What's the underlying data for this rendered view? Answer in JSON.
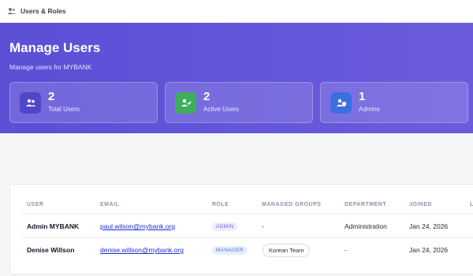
{
  "topbar": {
    "title": "Users & Roles",
    "icon": "users-icon"
  },
  "header": {
    "title": "Manage Users",
    "subtitle": "Manage users for MYBANK",
    "stats": [
      {
        "value": "2",
        "label": "Total Users",
        "icon": "users-icon",
        "color": "#4f46c8"
      },
      {
        "value": "2",
        "label": "Active Users",
        "icon": "user-check-icon",
        "color": "#3fae5a"
      },
      {
        "value": "1",
        "label": "Admins",
        "icon": "user-shield-icon",
        "color": "#3b6fe0"
      }
    ]
  },
  "table": {
    "columns": [
      "USER",
      "EMAIL",
      "ROLE",
      "MANAGED GROUPS",
      "DEPARTMENT",
      "JOINED",
      "LA"
    ],
    "rows": [
      {
        "user": "Admin MYBANK",
        "email": "paul.wilson@mybank.org",
        "role": "ADMIN",
        "managed_groups": "-",
        "department": "Administration",
        "joined": "Jan 24, 2026"
      },
      {
        "user": "Denise Willson",
        "email": "denise.willson@mybank.org",
        "role": "MANAGER",
        "managed_groups": "Korean Team",
        "department": "-",
        "joined": "Jan 24, 2026"
      }
    ]
  }
}
